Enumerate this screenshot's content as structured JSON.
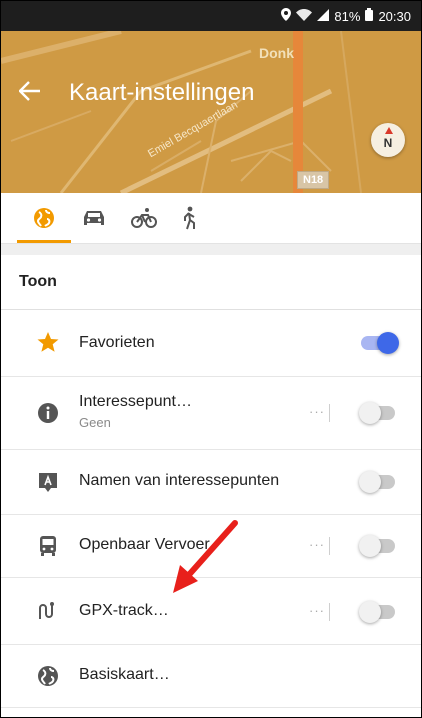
{
  "status_bar": {
    "battery_percent": "81%",
    "time": "20:30"
  },
  "header": {
    "title": "Kaart-instellingen",
    "map_labels": {
      "place": "Donk",
      "street": "Emiel Becquaertlaan",
      "road": "N18"
    },
    "compass": "N"
  },
  "tabs": [
    {
      "icon": "globe-icon",
      "selected": true
    },
    {
      "icon": "car-icon",
      "selected": false
    },
    {
      "icon": "bicycle-icon",
      "selected": false
    },
    {
      "icon": "pedestrian-icon",
      "selected": false
    }
  ],
  "section": {
    "title": "Toon"
  },
  "rows": [
    {
      "label": "Favorieten",
      "icon": "star-icon",
      "toggle": true
    },
    {
      "label": "Interessepunt…",
      "sub": "Geen",
      "icon": "info-icon",
      "more": "···",
      "toggle": false
    },
    {
      "label": "Namen van interessepunten",
      "icon": "poi-label-icon",
      "toggle": false
    },
    {
      "label": "Openbaar Vervoer",
      "icon": "bus-icon",
      "more": "···",
      "toggle": false
    },
    {
      "label": "GPX-track…",
      "icon": "route-icon",
      "more": "···",
      "toggle": false
    },
    {
      "label": "Basiskaart…",
      "icon": "globe-icon"
    }
  ],
  "colors": {
    "accent": "#f29a00",
    "toggle_on": "#3e68e8",
    "map": "#cf9a44",
    "annotation_arrow": "#e8201b"
  }
}
